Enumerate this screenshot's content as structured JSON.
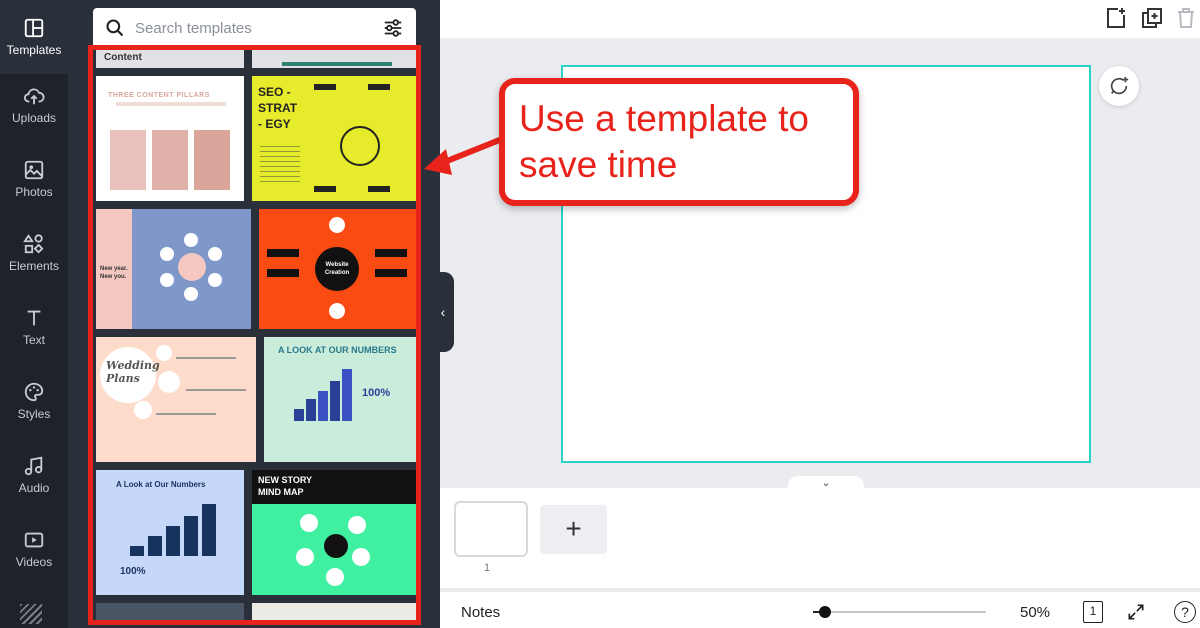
{
  "nav": {
    "items": [
      {
        "label": "Templates",
        "icon": "layout-icon"
      },
      {
        "label": "Uploads",
        "icon": "cloud-upload-icon"
      },
      {
        "label": "Photos",
        "icon": "image-icon"
      },
      {
        "label": "Elements",
        "icon": "shapes-icon"
      },
      {
        "label": "Text",
        "icon": "text-icon"
      },
      {
        "label": "Styles",
        "icon": "palette-icon"
      },
      {
        "label": "Audio",
        "icon": "music-note-icon"
      },
      {
        "label": "Videos",
        "icon": "video-icon"
      }
    ]
  },
  "search": {
    "placeholder": "Search templates"
  },
  "templates": [
    {
      "title": "Content",
      "bg": "#dfe1e4",
      "accent": "#333"
    },
    {
      "title": "",
      "bg": "#2e7f6f",
      "accent": "#2e7f6f"
    },
    {
      "title": "THREE CONTENT PILLARS",
      "bg": "#ffffff",
      "accent": "#d9a69c"
    },
    {
      "title": "SEO - STRAT - EGY",
      "bg": "#e6ec2b",
      "accent": "#222"
    },
    {
      "title": "New year. New you.",
      "bg": "#f4c8c1",
      "accent": "#7f97c9"
    },
    {
      "title": "Website Creation",
      "bg": "#fa4b12",
      "accent": "#111"
    },
    {
      "title": "Wedding Plans",
      "bg": "#fddccb",
      "accent": "#fff"
    },
    {
      "title": "A LOOK AT OUR NUMBERS",
      "bg": "#c9ecdb",
      "accent": "#2a3f96"
    },
    {
      "title": "A Look at Our Numbers",
      "bg": "#c6d8fa",
      "accent": "#16345f"
    },
    {
      "title": "NEW STORY MIND MAP",
      "bg": "#3ff0a1",
      "accent": "#111"
    }
  ],
  "stats": {
    "pct_a": "100%",
    "pct_b": "100%"
  },
  "callout": {
    "text": "Use a template to save time",
    "color": "#e8231b"
  },
  "pages": {
    "current": "1",
    "add": "+"
  },
  "footer": {
    "notes": "Notes",
    "zoom": "50%",
    "page_count": "1",
    "help": "?",
    "zoom_fraction": 0.05
  },
  "colors": {
    "canvas_border": "#2ad2c9",
    "highlight": "#e8231b",
    "panel": "#293039",
    "rail": "#1e2229"
  }
}
